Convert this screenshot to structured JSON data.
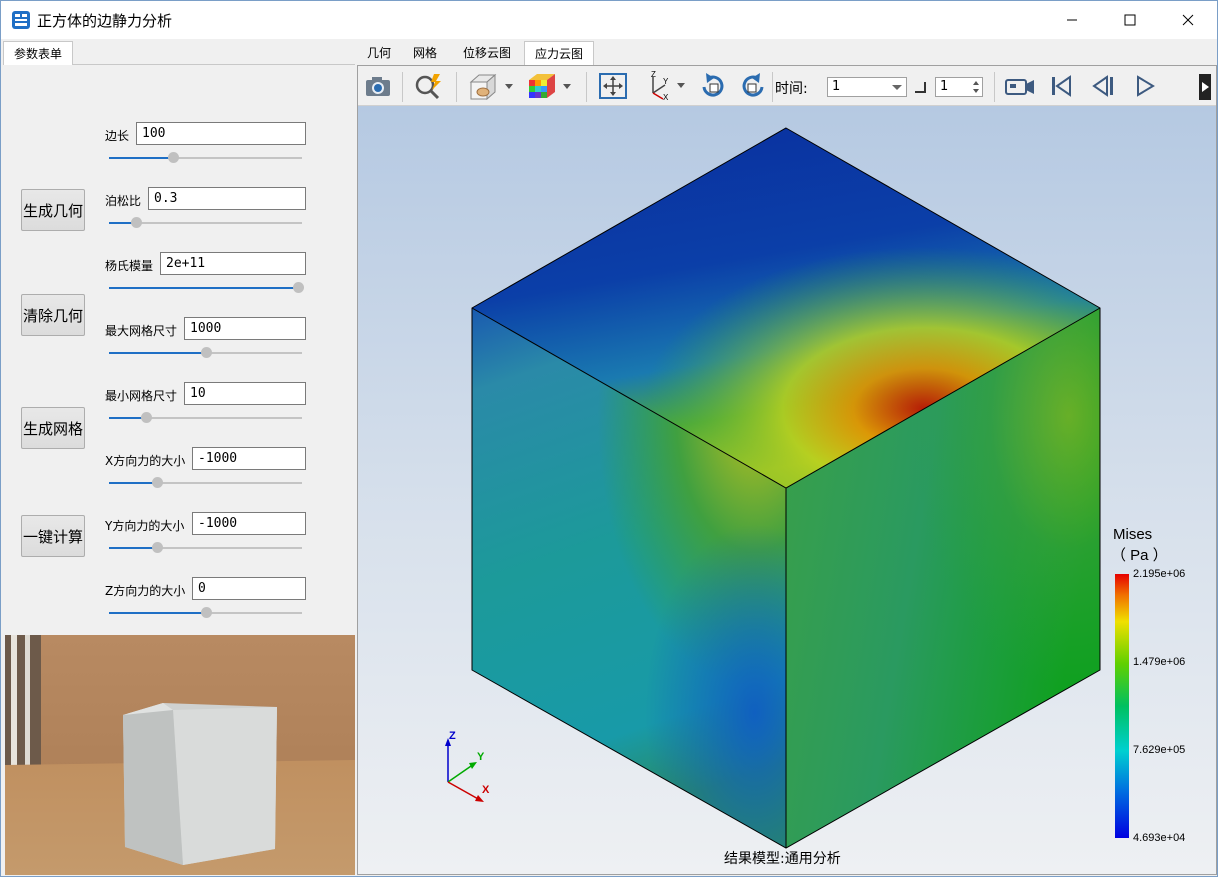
{
  "window": {
    "title": "正方体的边静力分析",
    "icon": "app-cube-icon"
  },
  "left_tabs": [
    {
      "label": "参数表单",
      "active": true
    }
  ],
  "side_buttons": [
    {
      "label": "生成几何"
    },
    {
      "label": "清除几何"
    },
    {
      "label": "生成网格"
    },
    {
      "label": "一键计算"
    }
  ],
  "params": [
    {
      "label": "边长",
      "value": "100",
      "slider_fraction": 0.33
    },
    {
      "label": "泊松比",
      "value": "0.3",
      "slider_fraction": 0.14
    },
    {
      "label": "杨氏模量",
      "value": "2e+11",
      "slider_fraction": 0.98
    },
    {
      "label": "最大网格尺寸",
      "value": "1000",
      "slider_fraction": 0.5
    },
    {
      "label": "最小网格尺寸",
      "value": "10",
      "slider_fraction": 0.19
    },
    {
      "label": "X方向力的大小",
      "value": "-1000",
      "slider_fraction": 0.25
    },
    {
      "label": "Y方向力的大小",
      "value": "-1000",
      "slider_fraction": 0.25
    },
    {
      "label": "Z方向力的大小",
      "value": "0",
      "slider_fraction": 0.5
    }
  ],
  "right_tabs": [
    {
      "label": "几何",
      "active": false
    },
    {
      "label": "网格",
      "active": false
    },
    {
      "label": "位移云图",
      "active": false
    },
    {
      "label": "应力云图",
      "active": true
    }
  ],
  "toolbar": {
    "icons": [
      "camera-icon",
      "zoom-query-icon",
      "view-style-icon",
      "color-map-icon",
      "fit-view-icon",
      "axes-icon",
      "rotate-cw-icon",
      "rotate-ccw-icon"
    ],
    "time_label": "时间:",
    "time_value": "1",
    "step_value": "1",
    "playback_icons": [
      "record-video-icon",
      "first-frame-icon",
      "prev-frame-icon",
      "play-icon"
    ]
  },
  "viewport": {
    "legend_title": "Mises",
    "legend_unit": "（ Pa ）",
    "legend_ticks": [
      "2.195e+06",
      "1.479e+06",
      "7.629e+05",
      "4.693e+04"
    ],
    "caption": "结果模型:通用分析",
    "triad": {
      "z": "Z",
      "y": "Y",
      "x": "X"
    }
  },
  "colors": {
    "accent": "#1f6fc5",
    "legend_high": "#e60000",
    "legend_low": "#0000e0"
  }
}
